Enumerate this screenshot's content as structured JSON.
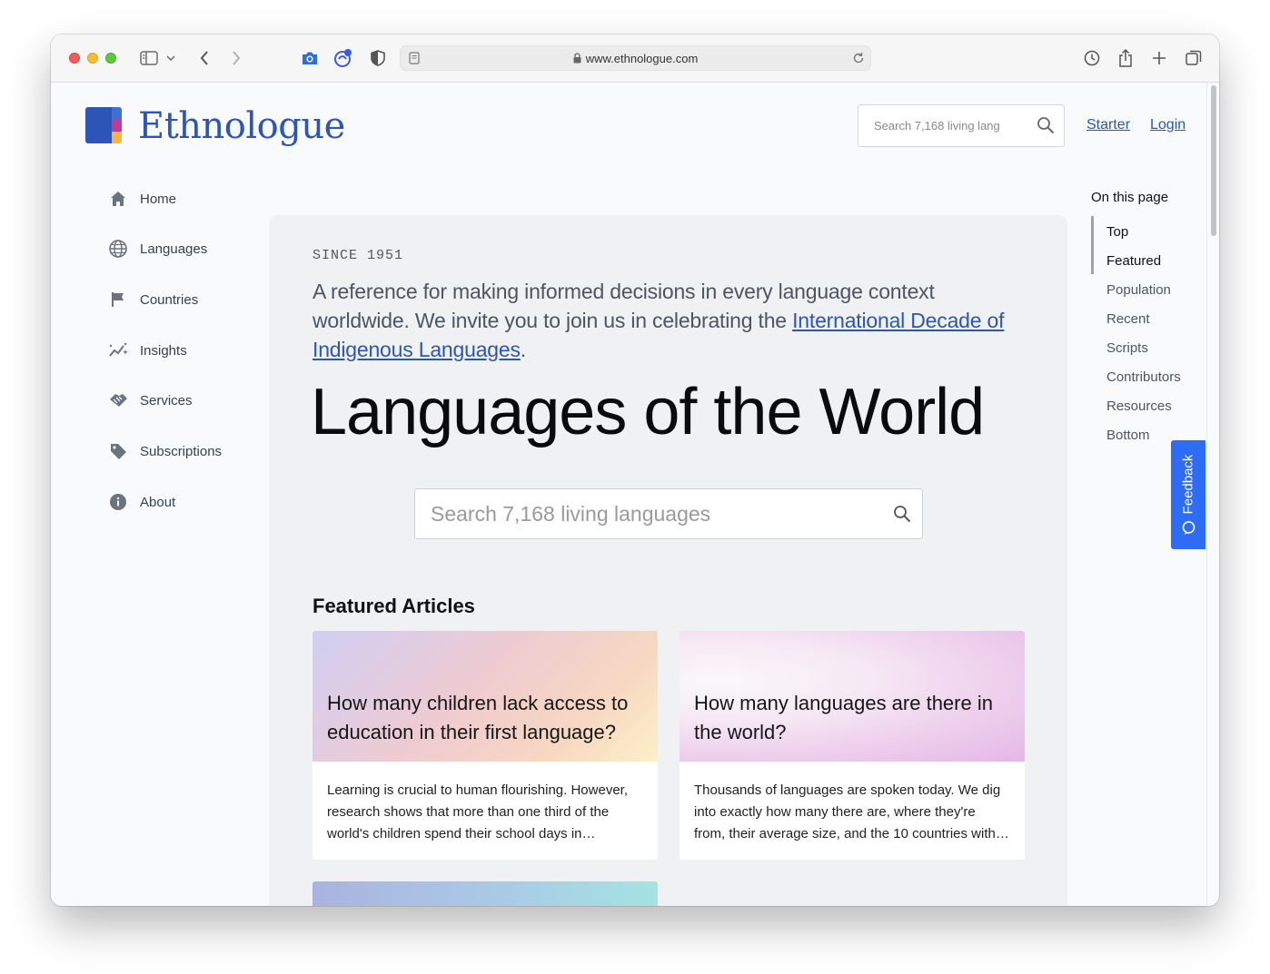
{
  "browser": {
    "url": "www.ethnologue.com"
  },
  "brand": {
    "name": "Ethnologue",
    "colors": {
      "primary": "#2b55b6",
      "accent_pink": "#c0399b",
      "accent_yellow": "#f4b63d",
      "feedback": "#2f6cf6"
    }
  },
  "header": {
    "search_placeholder": "Search 7,168 living lang",
    "links": [
      "Starter",
      "Login"
    ]
  },
  "nav": {
    "items": [
      {
        "label": "Home",
        "icon": "home-icon"
      },
      {
        "label": "Languages",
        "icon": "globe-icon"
      },
      {
        "label": "Countries",
        "icon": "flag-icon"
      },
      {
        "label": "Insights",
        "icon": "insights-icon"
      },
      {
        "label": "Services",
        "icon": "services-icon"
      },
      {
        "label": "Subscriptions",
        "icon": "tag-icon"
      },
      {
        "label": "About",
        "icon": "info-icon"
      }
    ]
  },
  "main": {
    "since": "SINCE 1951",
    "lead_text_1": "A reference for making informed decisions in every language context worldwide. We invite you to join us in celebrating the ",
    "lead_link": "International Decade of Indigenous Languages",
    "lead_text_2": ".",
    "hero_title": "Languages of the World",
    "search_placeholder": "Search 7,168 living languages",
    "featured_heading": "Featured Articles",
    "cards": [
      {
        "title": "How many children lack access to education in their first language?",
        "body": "Learning is crucial to human flourishing. However, research shows that more than one third of the world's children spend their school days in…"
      },
      {
        "title": "How many languages are there in the world?",
        "body": "Thousands of languages are spoken today. We dig into exactly how many there are, where they're from, their average size, and the 10 countries with…"
      }
    ]
  },
  "toc": {
    "heading": "On this page",
    "items": [
      "Top",
      "Featured",
      "Population",
      "Recent",
      "Scripts",
      "Contributors",
      "Resources",
      "Bottom"
    ]
  },
  "feedback": {
    "label": "Feedback"
  }
}
